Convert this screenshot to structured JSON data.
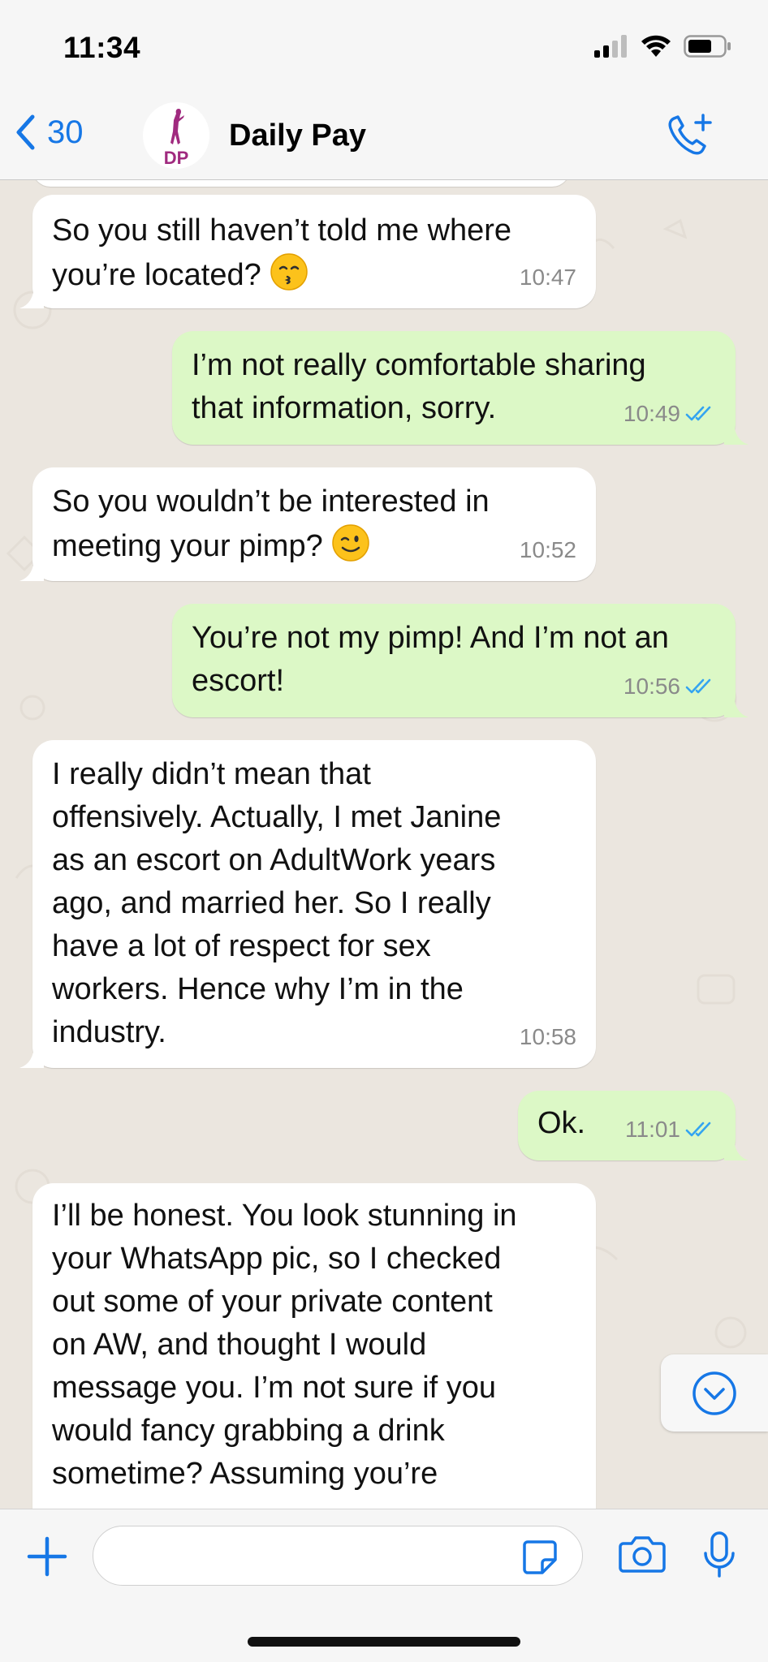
{
  "status_bar": {
    "time": "11:34"
  },
  "header": {
    "back_count": "30",
    "contact_name": "Daily Pay",
    "avatar_text": "DP"
  },
  "messages": [
    {
      "direction": "in",
      "lines": [
        "So you still haven’t told me where",
        "you’re located?"
      ],
      "emoji": "kissing-face",
      "time": "10:47"
    },
    {
      "direction": "out",
      "lines": [
        "I’m not really comfortable sharing",
        "that information, sorry."
      ],
      "time": "10:49",
      "status": "read"
    },
    {
      "direction": "in",
      "lines": [
        "So you wouldn’t be interested in",
        "meeting your pimp?"
      ],
      "emoji": "winking-face",
      "time": "10:52"
    },
    {
      "direction": "out",
      "lines": [
        "You’re not my pimp! And I’m not an",
        "escort!"
      ],
      "time": "10:56",
      "status": "read"
    },
    {
      "direction": "in",
      "lines": [
        "I really didn’t mean that",
        "offensively. Actually, I met Janine",
        "as an escort on AdultWork years",
        "ago, and married her. So I really",
        "have a lot of respect for sex",
        "workers. Hence why I’m in the",
        "industry."
      ],
      "time": "10:58"
    },
    {
      "direction": "out",
      "lines": [
        "Ok."
      ],
      "time": "11:01",
      "status": "read"
    },
    {
      "direction": "in",
      "lines": [
        "I’ll be honest. You look stunning in",
        "your WhatsApp pic, so I checked",
        "out some of your private content",
        "on AW, and thought I would",
        "message you. I’m not sure if you",
        "would fancy grabbing a drink",
        "sometime? Assuming you’re"
      ]
    }
  ],
  "input": {
    "placeholder": ""
  },
  "colors": {
    "accent": "#1677e6",
    "outgoing_bubble": "#dcf8c6",
    "incoming_bubble": "#ffffff",
    "chat_background": "#ebe6df",
    "read_ticks": "#34a4f0"
  }
}
